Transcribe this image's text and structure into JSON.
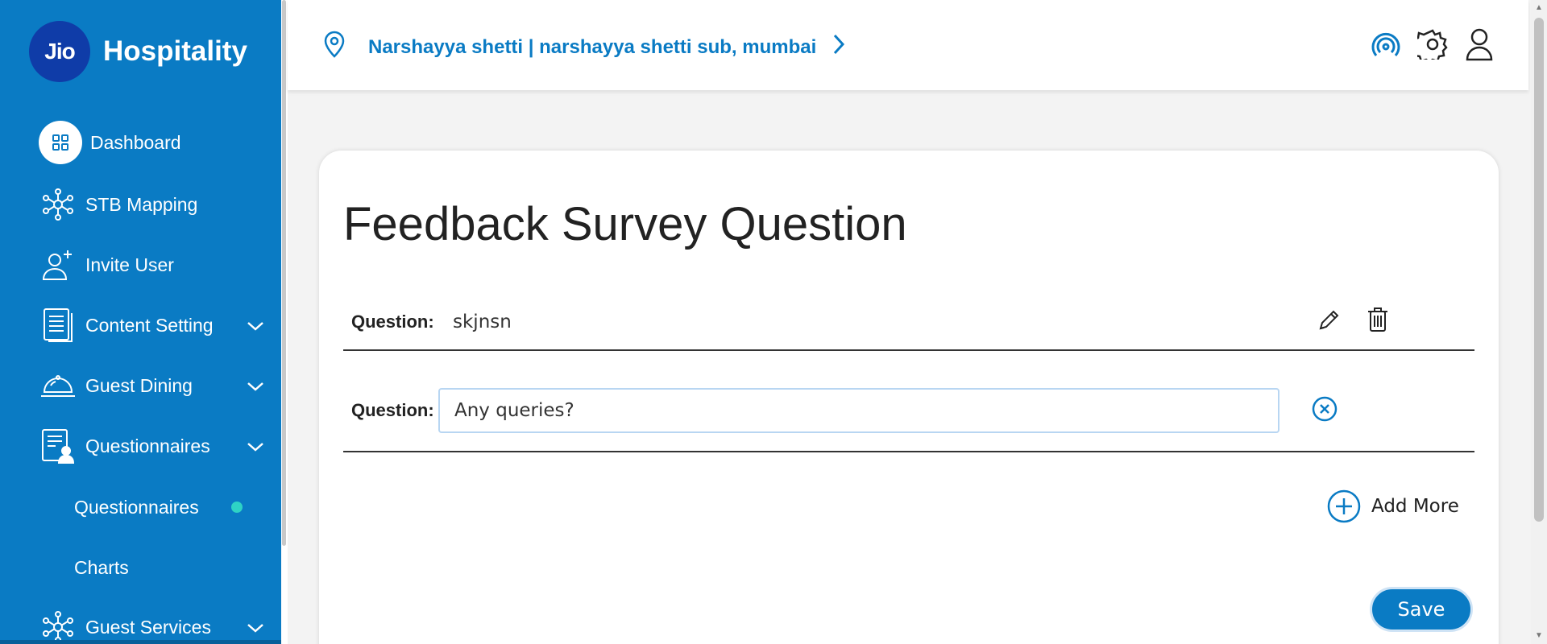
{
  "brand": {
    "logo_text": "Jio",
    "name": "Hospitality"
  },
  "sidebar": {
    "items": [
      {
        "label": "Dashboard"
      },
      {
        "label": "STB Mapping"
      },
      {
        "label": "Invite User"
      },
      {
        "label": "Content Setting"
      },
      {
        "label": "Guest Dining"
      },
      {
        "label": "Questionnaires"
      },
      {
        "label": "Guest Services"
      }
    ],
    "sub_items": [
      {
        "label": "Questionnaires",
        "active": true
      },
      {
        "label": "Charts"
      }
    ],
    "active_dot_color": "#2ed3c5"
  },
  "header": {
    "location": "Narshayya shetti | narshayya shetti sub, mumbai",
    "icons": [
      "broadcast-icon",
      "gear-icon",
      "user-icon"
    ]
  },
  "page": {
    "title": "Feedback Survey Question",
    "questions": [
      {
        "label": "Question:",
        "value": "skjnsn",
        "mode": "view"
      },
      {
        "label": "Question:",
        "value": "Any queries?",
        "mode": "edit"
      }
    ],
    "add_more_label": "Add More",
    "save_label": "Save"
  },
  "colors": {
    "accent": "#0a7bc4",
    "brand_dark": "#0f3ca8"
  }
}
